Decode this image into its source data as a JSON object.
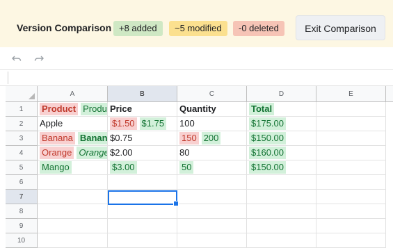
{
  "version_bar": {
    "title": "Version Comparison",
    "added_badge": "+8 added",
    "modified_badge": "~5 modified",
    "deleted_badge": "-0 deleted",
    "exit_button": "Exit Comparison"
  },
  "toolbar": {
    "undo_icon": "undo-icon",
    "redo_icon": "redo-icon"
  },
  "columns": [
    "A",
    "B",
    "C",
    "D",
    "E"
  ],
  "rows": [
    "1",
    "2",
    "3",
    "4",
    "5",
    "6",
    "7",
    "8",
    "9",
    "10"
  ],
  "cells": {
    "A1_old": "Product",
    "A1_new": "Produ",
    "B1": "Price",
    "C1": "Quantity",
    "D1": "Total",
    "A2": "Apple",
    "B2_old": "$1.50",
    "B2_new": "$1.75",
    "C2": "100",
    "D2": "$175.00",
    "A3_old": "Banana",
    "A3_new": "Banan",
    "B3": "$0.75",
    "C3_old": "150",
    "C3_new": "200",
    "D3": "$150.00",
    "A4_old": "Orange",
    "A4_new": "Orange",
    "B4": "$2.00",
    "C4": "80",
    "D4": "$160.00",
    "A5": "Mango",
    "B5": "$3.00",
    "C5": "50",
    "D5": "$150.00"
  },
  "colors": {
    "added_bg": "#d2f0da",
    "added_text": "#137333",
    "deleted_bg": "#f8d0d0",
    "deleted_text": "#c0392b",
    "modified_badge": "#fbe08f",
    "selection": "#1a73e8"
  }
}
